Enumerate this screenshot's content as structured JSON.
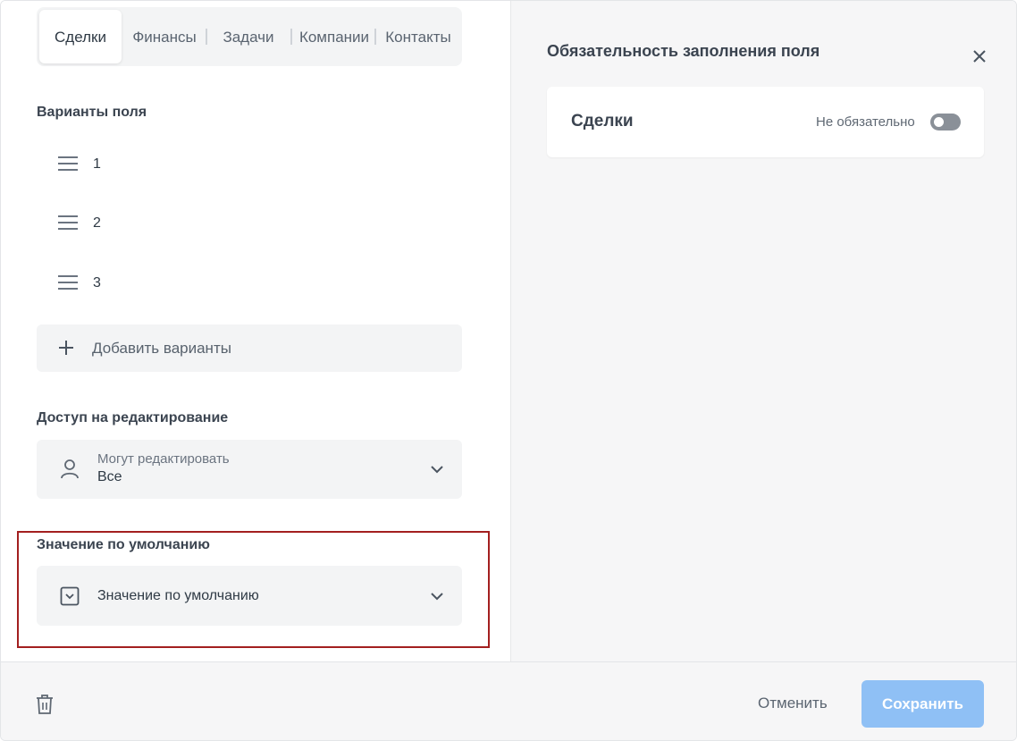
{
  "tabs": [
    {
      "label": "Сделки",
      "active": true
    },
    {
      "label": "Финансы",
      "active": false
    },
    {
      "label": "Задачи",
      "active": false
    },
    {
      "label": "Компании",
      "active": false
    },
    {
      "label": "Контакты",
      "active": false
    }
  ],
  "variants": {
    "title": "Варианты поля",
    "items": [
      "1",
      "2",
      "3"
    ],
    "add_label": "Добавить варианты"
  },
  "edit_access": {
    "title": "Доступ на редактирование",
    "label": "Могут редактировать",
    "value": "Все"
  },
  "default_value": {
    "title": "Значение по умолчанию",
    "placeholder": "Значение по умолчанию"
  },
  "panel": {
    "title": "Обязательность заполнения поля",
    "card_title": "Сделки",
    "status": "Не обязательно",
    "toggle_on": false
  },
  "footer": {
    "cancel_label": "Отменить",
    "save_label": "Сохранить"
  },
  "colors": {
    "save_button": "#8fc0f5",
    "highlight_border": "#a31f1f",
    "toggle_off": "#8a9098"
  },
  "icons": [
    "drag-handle-icon",
    "plus-icon",
    "user-icon",
    "chevron-down-icon",
    "dropdown-box-icon",
    "close-icon",
    "trash-icon"
  ]
}
